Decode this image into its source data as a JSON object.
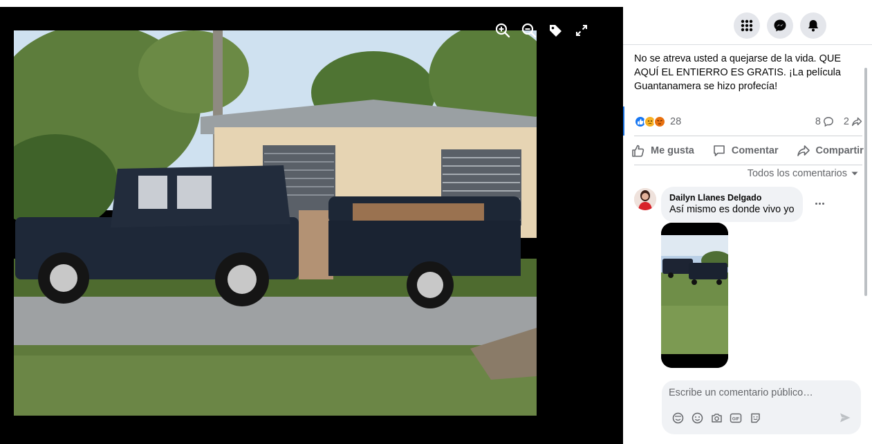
{
  "viewer": {
    "tools": [
      {
        "icon": "zoom-in-icon"
      },
      {
        "icon": "zoom-out-icon"
      },
      {
        "icon": "tag-icon"
      },
      {
        "icon": "fullscreen-icon"
      }
    ]
  },
  "topbar": {
    "icons": [
      "menu-grid-icon",
      "messenger-icon",
      "notifications-bell-icon"
    ]
  },
  "post": {
    "text": "No se atreva usted a quejarse de la vida. QUE AQUÍ EL ENTIERRO ES GRATIS. ¡La película Guantanamera se hizo profecía!",
    "reactions_count": "28",
    "reaction_icons": [
      "like-reaction-icon",
      "sad-reaction-icon",
      "angry-reaction-icon"
    ],
    "comments_count": "8",
    "shares_count": "2"
  },
  "actions": {
    "like": "Me gusta",
    "comment": "Comentar",
    "share": "Compartir"
  },
  "comments_sort": "Todos los comentarios",
  "comment": {
    "author": "Dailyn Llanes Delgado",
    "text": "Así mismo es donde vivo yo"
  },
  "composer": {
    "placeholder": "Escribe un comentario público…",
    "icons": [
      "sticker-icon",
      "emoji-icon",
      "camera-icon",
      "gif-icon",
      "avatar-sticker-icon"
    ]
  },
  "colors": {
    "accent": "#1b74e4",
    "secondary_text": "#65676b",
    "bubble_bg": "#f0f2f5"
  }
}
